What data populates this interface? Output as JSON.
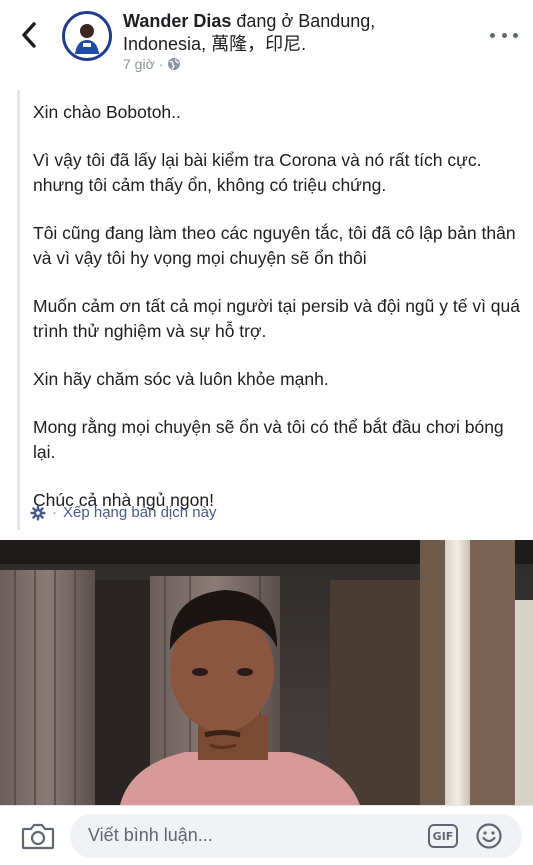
{
  "header": {
    "author_name": "Wander Dias",
    "location_text": " đang ở Bandung, Indonesia, 萬隆，印尼.",
    "timestamp": "7 giờ",
    "separator": "·",
    "privacy_icon": "globe-icon",
    "back_icon": "chevron-left-icon",
    "more_icon": "more-dots-icon"
  },
  "post": {
    "paragraphs": [
      "Xin chào Bobotoh..",
      "Vì vậy tôi đã lấy lại bài kiểm tra Corona và nó rất tích cực. nhưng tôi cảm thấy ổn, không có triệu chứng.",
      "Tôi cũng đang làm theo các nguyên tắc, tôi đã cô lập bản thân và vì vậy tôi hy vọng mọi chuyện sẽ ổn thôi",
      "Muốn cảm ơn tất cả mọi người tại persib và đội ngũ y tế vì quá trình thử nghiệm và sự hỗ trợ.",
      "Xin hãy chăm sóc và luôn khỏe mạnh.",
      "Mong rằng mọi chuyện sẽ ổn và tôi có thể bắt đầu chơi bóng lại.",
      "Chúc cả nhà ngủ ngon!"
    ],
    "translate_separator": "·",
    "translate_label": "Xếp hạng bản dịch này"
  },
  "comment_bar": {
    "placeholder": "Viết bình luận...",
    "gif_label": "GIF",
    "camera_icon": "camera-icon",
    "emoji_icon": "emoji-icon"
  },
  "colors": {
    "accent": "#4b5a8c",
    "muted": "#8d949e",
    "text": "#1c1e21",
    "input_bg": "#f0f2f5"
  }
}
